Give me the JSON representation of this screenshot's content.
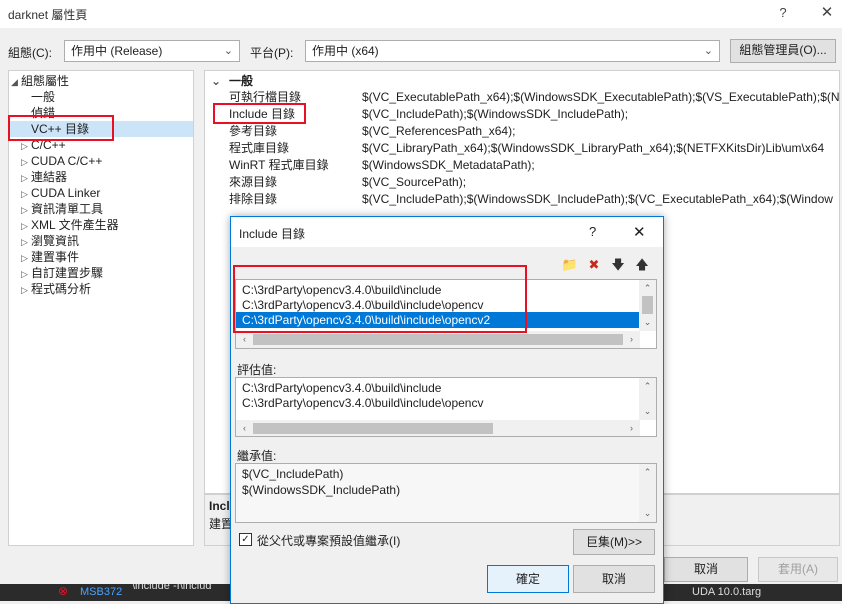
{
  "window": {
    "title": "darknet 屬性頁",
    "help_glyph": "?",
    "close_glyph": "✕"
  },
  "toolbar": {
    "config_label": "組態(C):",
    "config_value": "作用中 (Release)",
    "platform_label": "平台(P):",
    "platform_value": "作用中 (x64)",
    "config_manager": "組態管理員(O)..."
  },
  "tree": {
    "root": "組態屬性",
    "items": [
      {
        "label": "一般",
        "indent": 2,
        "expander": ""
      },
      {
        "label": "偵錯",
        "indent": 2,
        "expander": ""
      },
      {
        "label": "VC++ 目錄",
        "indent": 2,
        "expander": "",
        "selected": true
      },
      {
        "label": "C/C++",
        "indent": 1,
        "expander": "▷"
      },
      {
        "label": "CUDA C/C++",
        "indent": 1,
        "expander": "▷"
      },
      {
        "label": "連結器",
        "indent": 1,
        "expander": "▷"
      },
      {
        "label": "CUDA Linker",
        "indent": 1,
        "expander": "▷"
      },
      {
        "label": "資訊清單工具",
        "indent": 1,
        "expander": "▷"
      },
      {
        "label": "XML 文件產生器",
        "indent": 1,
        "expander": "▷"
      },
      {
        "label": "瀏覽資訊",
        "indent": 1,
        "expander": "▷"
      },
      {
        "label": "建置事件",
        "indent": 1,
        "expander": "▷"
      },
      {
        "label": "自訂建置步驟",
        "indent": 1,
        "expander": "▷"
      },
      {
        "label": "程式碼分析",
        "indent": 1,
        "expander": "▷"
      }
    ]
  },
  "properties": {
    "section": "一般",
    "rows": [
      {
        "name": "可執行檔目錄",
        "value": "$(VC_ExecutablePath_x64);$(WindowsSDK_ExecutablePath);$(VS_ExecutablePath);$(N"
      },
      {
        "name": "Include 目錄",
        "value": "$(VC_IncludePath);$(WindowsSDK_IncludePath);"
      },
      {
        "name": "參考目錄",
        "value": "$(VC_ReferencesPath_x64);"
      },
      {
        "name": "程式庫目錄",
        "value": "$(VC_LibraryPath_x64);$(WindowsSDK_LibraryPath_x64);$(NETFXKitsDir)Lib\\um\\x64"
      },
      {
        "name": "WinRT 程式庫目錄",
        "value": "$(WindowsSDK_MetadataPath);"
      },
      {
        "name": "來源目錄",
        "value": "$(VC_SourcePath);"
      },
      {
        "name": "排除目錄",
        "value": "$(VC_IncludePath);$(WindowsSDK_IncludePath);$(VC_ExecutablePath_x64);$(Window"
      }
    ],
    "desc_title": "Incl",
    "desc_text": "建置"
  },
  "main_buttons": {
    "cancel": "取消",
    "apply": "套用(A)"
  },
  "dialog": {
    "title": "Include 目錄",
    "help_glyph": "?",
    "close_glyph": "✕",
    "tools": {
      "new_folder": "📁",
      "delete": "✖",
      "down": "🡇",
      "up": "🡅"
    },
    "entries": [
      {
        "text": "C:\\3rdParty\\opencv3.4.0\\build\\include"
      },
      {
        "text": "C:\\3rdParty\\opencv3.4.0\\build\\include\\opencv"
      },
      {
        "text": "C:\\3rdParty\\opencv3.4.0\\build\\include\\opencv2",
        "selected": true
      }
    ],
    "evaluated_label": "評估值:",
    "evaluated": [
      "C:\\3rdParty\\opencv3.4.0\\build\\include",
      "C:\\3rdParty\\opencv3.4.0\\build\\include\\opencv"
    ],
    "inherited_label": "繼承值:",
    "inherited": [
      "$(VC_IncludePath)",
      "$(WindowsSDK_IncludePath)"
    ],
    "inherit_checkbox": "從父代或專案預設值繼承(I)",
    "inherit_checked": "✓",
    "macros": "巨集(M)>>",
    "ok": "確定",
    "cancel": "取消"
  },
  "taskbar": {
    "left_text": "MSB372",
    "left_text2": "\\include -I\\includ",
    "right_text": "UDA 10.0.targ"
  },
  "colors": {
    "accent": "#0078d7",
    "highlight_box": "#e81123",
    "tree_selected": "#cce4f7"
  }
}
